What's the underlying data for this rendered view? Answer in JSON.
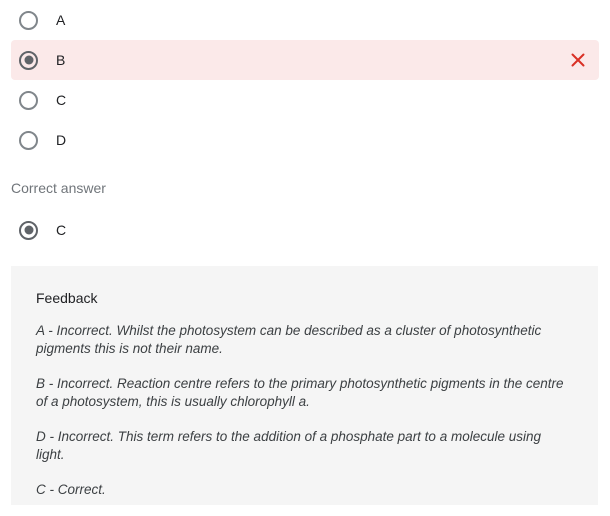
{
  "options": [
    {
      "label": "A",
      "selected": false,
      "state": "neutral"
    },
    {
      "label": "B",
      "selected": true,
      "state": "wrong"
    },
    {
      "label": "C",
      "selected": false,
      "state": "neutral"
    },
    {
      "label": "D",
      "selected": false,
      "state": "neutral"
    }
  ],
  "wrong_icon": "close-icon",
  "correct_answer": {
    "title": "Correct answer",
    "label": "C"
  },
  "feedback": {
    "title": "Feedback",
    "paragraphs": [
      "A - Incorrect. Whilst the photosystem can be described as a cluster of photosynthetic pigments this is not their name.",
      "B - Incorrect. Reaction centre refers to the primary photosynthetic pigments in the centre of a photosystem, this is usually chlorophyll a.",
      "D - Incorrect. This term refers to the addition of a phosphate part to a molecule using light.",
      "C - Correct."
    ]
  },
  "colors": {
    "wrong_row_background": "#fbe9e9",
    "wrong_icon": "#d93025",
    "feedback_background": "#f5f5f5",
    "radio_border": "#80868b",
    "radio_checked": "#5f6368",
    "label_muted": "#70757a",
    "text_primary": "#202124"
  }
}
